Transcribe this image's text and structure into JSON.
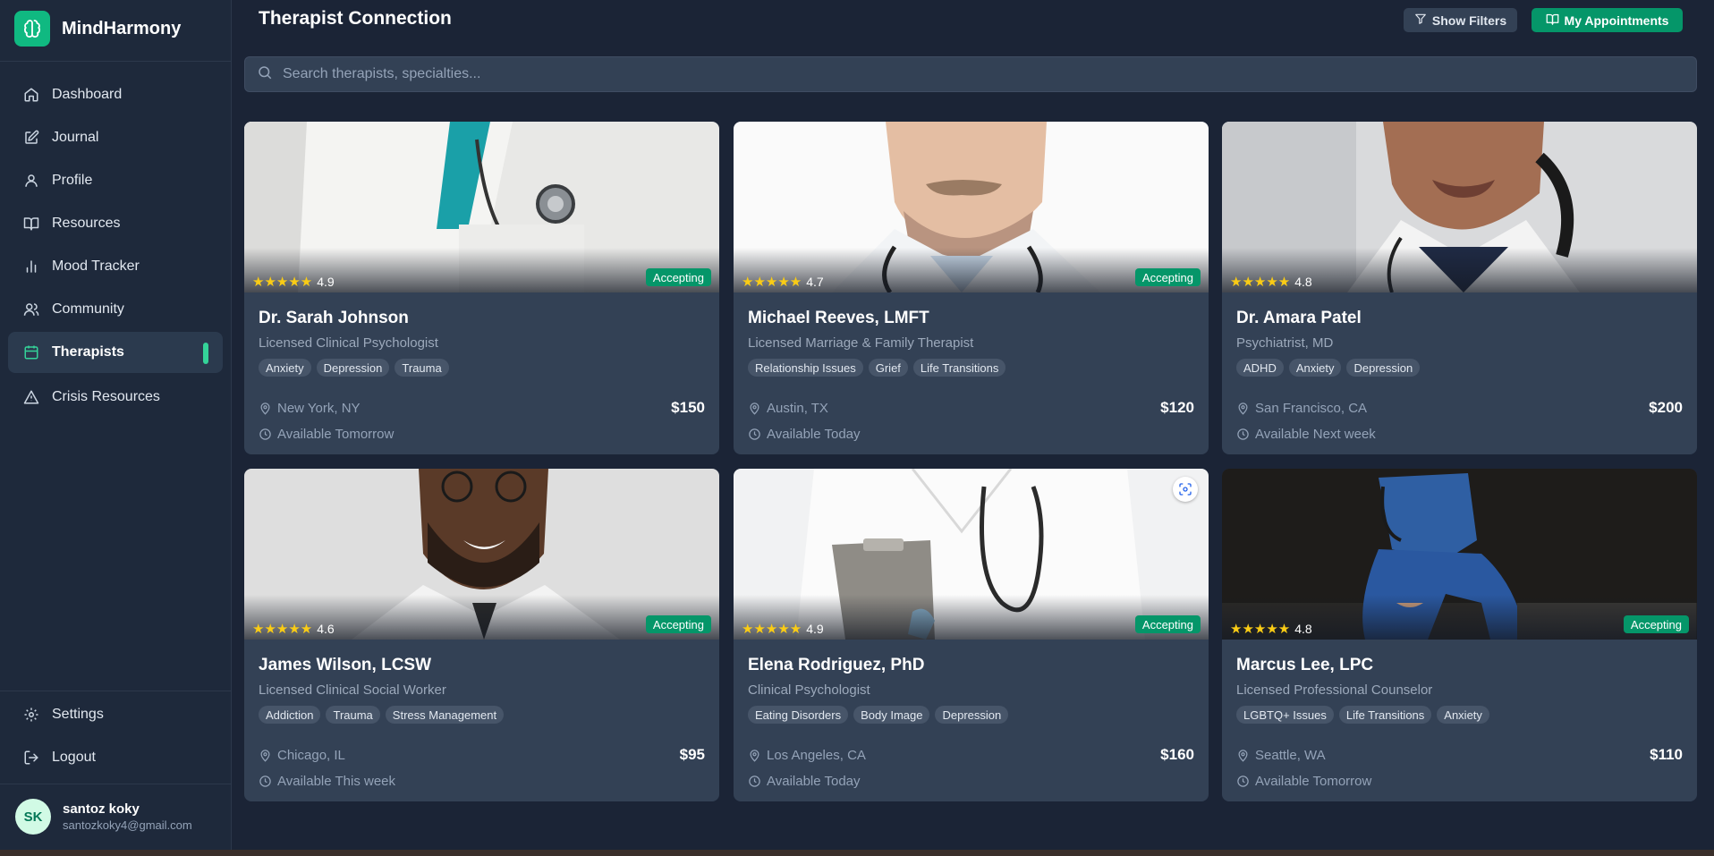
{
  "brand": {
    "name": "MindHarmony"
  },
  "nav": [
    {
      "label": "Dashboard",
      "icon": "home-icon"
    },
    {
      "label": "Journal",
      "icon": "edit-icon"
    },
    {
      "label": "Profile",
      "icon": "user-icon"
    },
    {
      "label": "Resources",
      "icon": "book-icon"
    },
    {
      "label": "Mood Tracker",
      "icon": "bar-chart-icon"
    },
    {
      "label": "Community",
      "icon": "users-icon"
    },
    {
      "label": "Therapists",
      "icon": "calendar-icon",
      "active": true
    },
    {
      "label": "Crisis Resources",
      "icon": "alert-triangle-icon"
    }
  ],
  "bottom_nav": [
    {
      "label": "Settings",
      "icon": "gear-icon"
    },
    {
      "label": "Logout",
      "icon": "logout-icon"
    }
  ],
  "user": {
    "initials": "SK",
    "name": "santoz koky",
    "email": "santozkoky4@gmail.com"
  },
  "header": {
    "title": "Therapist Connection",
    "filters_label": "Show Filters",
    "appointments_label": "My Appointments"
  },
  "search": {
    "placeholder": "Search therapists, specialties..."
  },
  "therapists": [
    {
      "name": "Dr. Sarah Johnson",
      "title": "Licensed Clinical Psychologist",
      "tags": [
        "Anxiety",
        "Depression",
        "Trauma"
      ],
      "rating": "4.9",
      "status": "Accepting",
      "location": "New York, NY",
      "price": "$150",
      "availability": "Available Tomorrow"
    },
    {
      "name": "Michael Reeves, LMFT",
      "title": "Licensed Marriage & Family Therapist",
      "tags": [
        "Relationship Issues",
        "Grief",
        "Life Transitions"
      ],
      "rating": "4.7",
      "status": "Accepting",
      "location": "Austin, TX",
      "price": "$120",
      "availability": "Available Today"
    },
    {
      "name": "Dr. Amara Patel",
      "title": "Psychiatrist, MD",
      "tags": [
        "ADHD",
        "Anxiety",
        "Depression"
      ],
      "rating": "4.8",
      "status": "",
      "location": "San Francisco, CA",
      "price": "$200",
      "availability": "Available Next week"
    },
    {
      "name": "James Wilson, LCSW",
      "title": "Licensed Clinical Social Worker",
      "tags": [
        "Addiction",
        "Trauma",
        "Stress Management"
      ],
      "rating": "4.6",
      "status": "Accepting",
      "location": "Chicago, IL",
      "price": "$95",
      "availability": "Available This week"
    },
    {
      "name": "Elena Rodriguez, PhD",
      "title": "Clinical Psychologist",
      "tags": [
        "Eating Disorders",
        "Body Image",
        "Depression"
      ],
      "rating": "4.9",
      "status": "Accepting",
      "location": "Los Angeles, CA",
      "price": "$160",
      "availability": "Available Today"
    },
    {
      "name": "Marcus Lee, LPC",
      "title": "Licensed Professional Counselor",
      "tags": [
        "LGBTQ+ Issues",
        "Life Transitions",
        "Anxiety"
      ],
      "rating": "4.8",
      "status": "Accepting",
      "location": "Seattle, WA",
      "price": "$110",
      "availability": "Available Tomorrow"
    }
  ],
  "stars": "★★★★★",
  "colors": {
    "accent": "#10b981",
    "accepting": "#059669",
    "star": "#facc15"
  }
}
